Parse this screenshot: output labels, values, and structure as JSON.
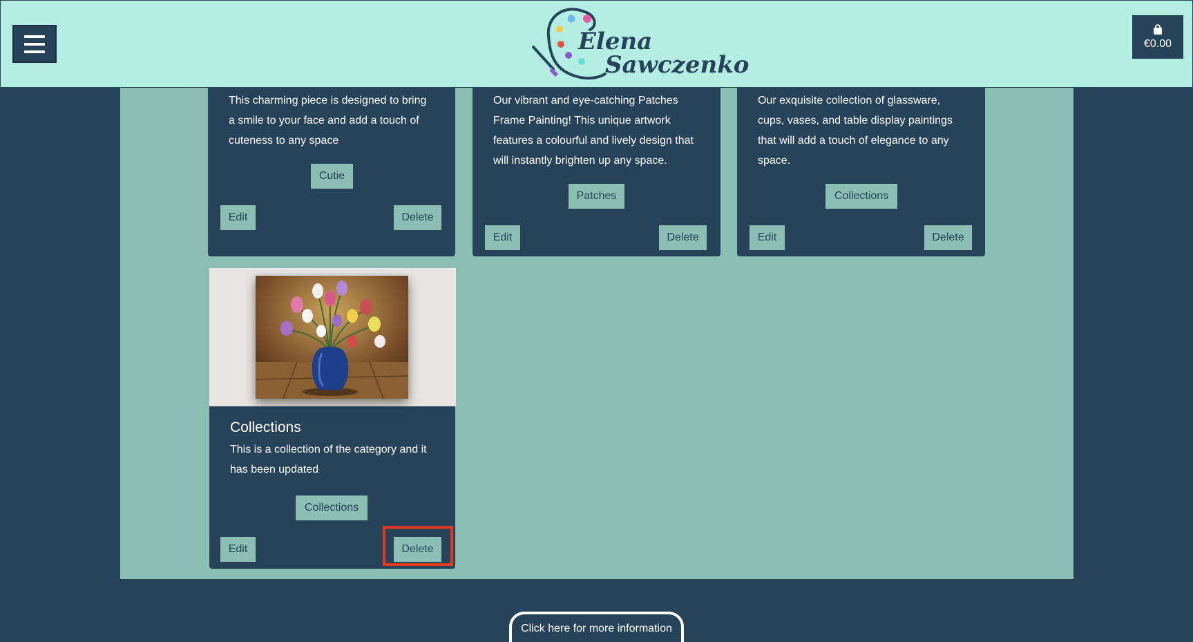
{
  "header": {
    "logo_line1": "Elena",
    "logo_line2": "Sawczenko",
    "cart_total": "€0.00"
  },
  "cards": [
    {
      "description_lines": [
        "This charming piece is designed to bring",
        "a smile to your face and add a touch of",
        "cuteness to any space"
      ],
      "category": "Cutie",
      "edit_label": "Edit",
      "delete_label": "Delete"
    },
    {
      "description_lines": [
        "Our vibrant and eye-catching Patches",
        "Frame Painting! This unique artwork",
        "features a colourful and lively design that",
        "will instantly brighten up any space."
      ],
      "category": "Patches",
      "edit_label": "Edit",
      "delete_label": "Delete"
    },
    {
      "description_lines": [
        "Our exquisite collection of glassware,",
        "cups, vases, and table display paintings",
        "that will add a touch of elegance to any",
        "space."
      ],
      "category": "Collections",
      "edit_label": "Edit",
      "delete_label": "Delete"
    },
    {
      "title": "Collections",
      "description_lines": [
        "This is a collection of the category and it",
        "has been updated"
      ],
      "category": "Collections",
      "edit_label": "Edit",
      "delete_label": "Delete"
    }
  ],
  "footer": {
    "info_label": "Click here for more information"
  },
  "colors": {
    "header_bg": "#b4eee2",
    "page_bg": "#27435a",
    "content_bg": "#8bbfb3",
    "highlight": "#e03a1e"
  }
}
